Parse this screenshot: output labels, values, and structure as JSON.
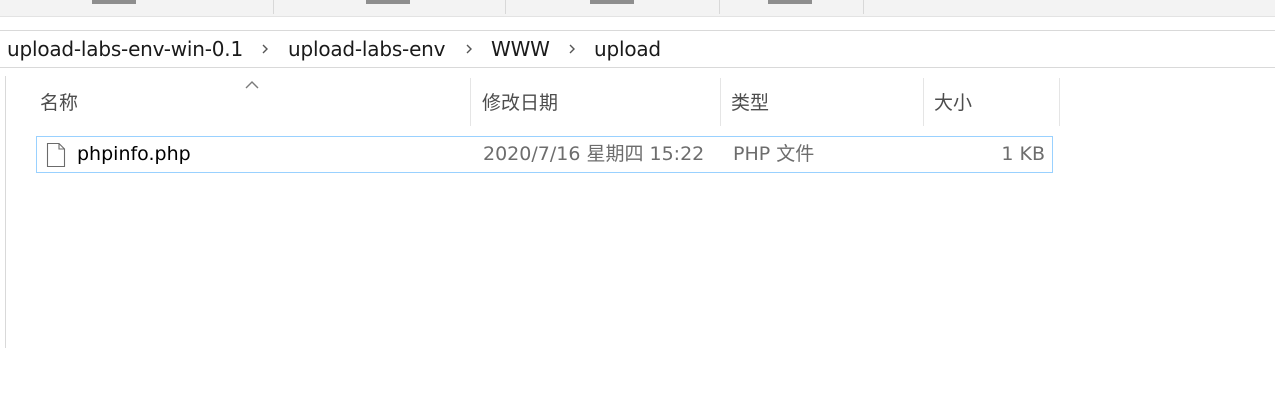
{
  "breadcrumb": {
    "items": [
      {
        "label": "upload-labs-env-win-0.1"
      },
      {
        "label": "upload-labs-env"
      },
      {
        "label": "WWW"
      },
      {
        "label": "upload"
      }
    ],
    "separator_icon": "chevron-right-icon"
  },
  "columns": {
    "name": "名称",
    "date": "修改日期",
    "type": "类型",
    "size": "大小",
    "sort_indicator_icon": "sort-up-caret-icon"
  },
  "files": [
    {
      "name": "phpinfo.php",
      "date_modified": "2020/7/16 星期四 15:22",
      "type": "PHP 文件",
      "size": "1 KB",
      "icon": "document-icon"
    }
  ],
  "colors": {
    "selection_border": "#99d1ff",
    "header_text": "#4d4d4d",
    "secondary_text": "#6d6d6d"
  }
}
